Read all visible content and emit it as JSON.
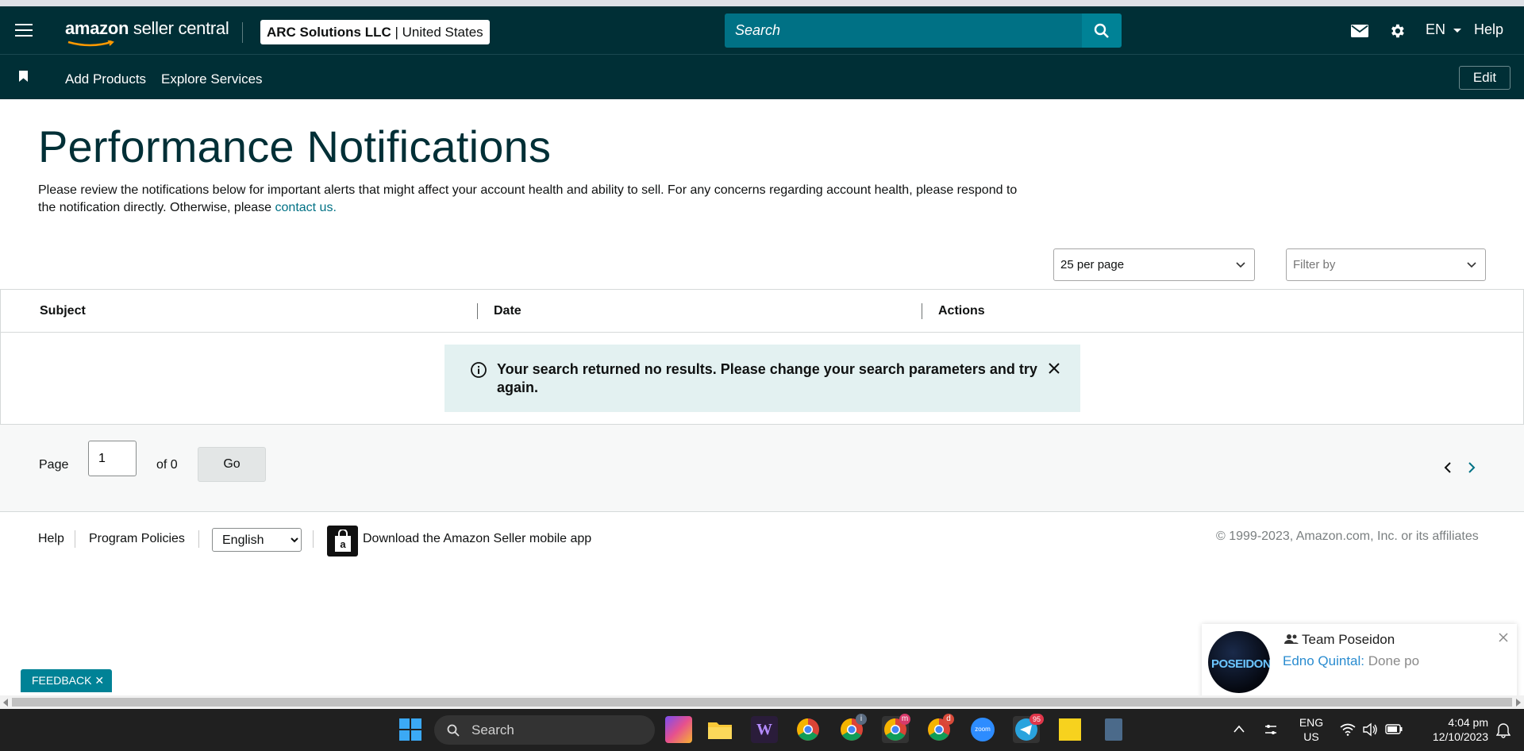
{
  "header": {
    "logo_regular": "amazon",
    "logo_bold": " seller central",
    "account_name": "ARC Solutions LLC",
    "account_region": " | United States",
    "search_placeholder": "Search",
    "language": "EN",
    "help_label": "Help"
  },
  "subnav": {
    "items": [
      "Add Products",
      "Explore Services"
    ],
    "edit_label": "Edit"
  },
  "page": {
    "title": "Performance Notifications",
    "intro_text": "Please review the notifications below for important alerts that might affect your account health and ability to sell. For any concerns regarding account health, please respond to the notification directly. Otherwise, please ",
    "intro_link": "contact us."
  },
  "filters": {
    "per_page": "25 per page",
    "filter_placeholder": "Filter by"
  },
  "table": {
    "columns": [
      "Subject",
      "Date",
      "Actions"
    ],
    "empty_message": "Your search returned no results. Please change your search parameters and try again."
  },
  "pagination": {
    "page_label": "Page",
    "current_page": "1",
    "of_label": "of 0",
    "go_label": "Go"
  },
  "footer": {
    "help": "Help",
    "program_policies": "Program Policies",
    "language_selected": "English",
    "app_download": "Download the Amazon Seller mobile app",
    "copyright": "© 1999-2023, Amazon.com, Inc. or its affiliates"
  },
  "feedback": {
    "label": "FEEDBACK ✕"
  },
  "chat_toast": {
    "avatar_text": "POSEIDON",
    "team": "Team Poseidon",
    "sender": "Edno Quintal",
    "message": " Done po"
  },
  "taskbar": {
    "search_label": "Search",
    "lang_top": "ENG",
    "lang_bottom": "US",
    "time": "4:04 pm",
    "date": "12/10/2023",
    "badges": {
      "chrome_profile2": "i",
      "chrome_profile3": "m",
      "chrome_profile4": "d",
      "telegram": "95"
    }
  },
  "colors": {
    "nav_bg": "#002f36",
    "accent_teal": "#008296",
    "link": "#007185",
    "alert_bg": "#e3f1f1"
  }
}
